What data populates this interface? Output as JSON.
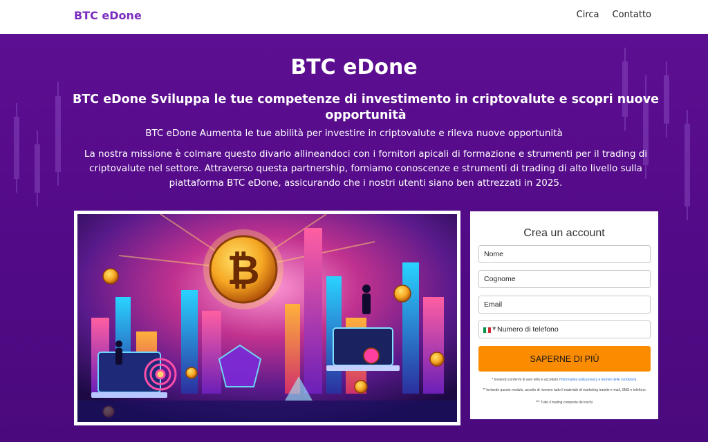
{
  "header": {
    "brand": "BTC eDone",
    "nav": [
      {
        "label": "Circa"
      },
      {
        "label": "Contatto"
      }
    ]
  },
  "hero": {
    "title": "BTC eDone",
    "subtitle": "BTC eDone Sviluppa le tue competenze di investimento in criptovalute e scopri nuove opportunità",
    "lead": "BTC eDone Aumenta le tue abilità per investire in criptovalute e rileva nuove opportunità",
    "paragraph": "La nostra missione è colmare questo divario allineandoci con i fornitori apicali di formazione e strumenti per il trading di criptovalute nel settore. Attraverso questa partnership, forniamo conoscenze e strumenti di trading di alto livello sulla piattaforma BTC eDone, assicurando che i nostri utenti siano ben attrezzati in 2025."
  },
  "form": {
    "title": "Crea un account",
    "first_name_placeholder": "Nome",
    "last_name_placeholder": "Cognome",
    "email_placeholder": "Email",
    "phone_placeholder": "Numero di telefono",
    "submit_label": "SAPERNE DI PIÙ",
    "disclaimer1_prefix": "* Inviando confermi di aver letto e accettato l'",
    "disclaimer1_link": "informativa sulla privacy e termini delle condizioni",
    "disclaimer1_suffix": ".",
    "disclaimer2": "** Inviando questo modulo, accetto di ricevere tutto il materiale di marketing tramite e-mail, SMS e telefono.",
    "disclaimer3": "*** Tutto il trading comporta dei rischi."
  },
  "colors": {
    "brand_purple": "#7b2cbf",
    "hero_bg": "#5a0f8c",
    "cta_orange": "#fb8c00"
  },
  "icons": {
    "flag": "italy-flag-icon",
    "hero_art": "bitcoin-illustration"
  }
}
